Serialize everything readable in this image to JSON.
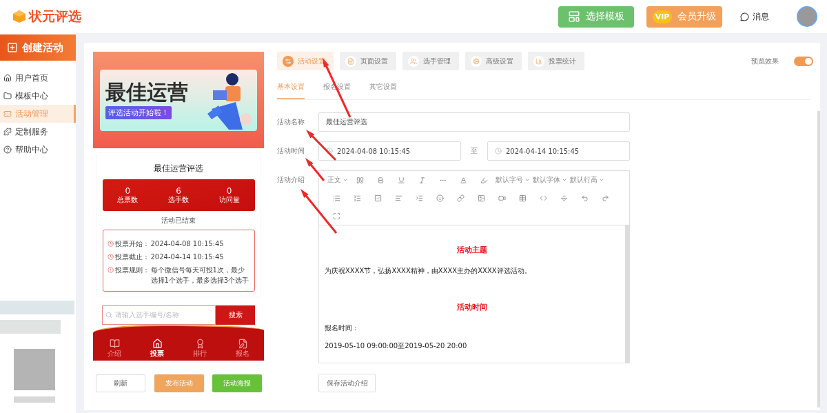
{
  "header": {
    "logo": "状元评选",
    "actions": [
      {
        "label": "选择模板",
        "kind": "template"
      },
      {
        "label": "会员升级",
        "kind": "vip",
        "badge": "VIP"
      }
    ],
    "messages": "消息"
  },
  "sidebar": {
    "create": "创建活动",
    "items": [
      {
        "label": "用户首页",
        "selected": false
      },
      {
        "label": "模板中心",
        "selected": false
      },
      {
        "label": "活动管理",
        "selected": true
      },
      {
        "label": "定制服务",
        "selected": false
      },
      {
        "label": "帮助中心",
        "selected": false
      }
    ]
  },
  "preview": {
    "banner_title": "最佳运营",
    "banner_subtitle": "评选活动开始啦！",
    "activity_title": "最佳运营评选",
    "stats": [
      {
        "value": "0",
        "label": "总票数"
      },
      {
        "value": "6",
        "label": "选手数"
      },
      {
        "value": "0",
        "label": "访问量"
      }
    ],
    "status": "活动已结束",
    "info": [
      {
        "kind": "clock",
        "label": "投票开始：",
        "value": "2024-04-08 10:15:45"
      },
      {
        "kind": "clock",
        "label": "投票截止：",
        "value": "2024-04-14 10:15:45"
      },
      {
        "kind": "alert",
        "label": "投票规则：",
        "value": "每个微信号每天可投1次，最少选择1个选手，最多选择3个选手"
      }
    ],
    "search": {
      "placeholder": "请输入选手编号/名称",
      "button": "搜索"
    },
    "nav": [
      {
        "label": "介绍",
        "selected": false
      },
      {
        "label": "投票",
        "selected": true
      },
      {
        "label": "排行",
        "selected": false
      },
      {
        "label": "报名",
        "selected": false
      }
    ],
    "buttons": [
      {
        "label": "刷新",
        "kind": "plain"
      },
      {
        "label": "发布活动",
        "kind": "orange"
      },
      {
        "label": "活动海报",
        "kind": "green"
      }
    ]
  },
  "tabs": [
    {
      "label": "活动设置",
      "selected": true
    },
    {
      "label": "页面设置",
      "selected": false
    },
    {
      "label": "选手管理",
      "selected": false
    },
    {
      "label": "高级设置",
      "selected": false
    },
    {
      "label": "投票统计",
      "selected": false
    }
  ],
  "preview_toggle": {
    "label": "预览效果",
    "on": true
  },
  "subtabs": [
    {
      "label": "基本设置",
      "selected": true
    },
    {
      "label": "报名设置",
      "selected": false
    },
    {
      "label": "其它设置",
      "selected": false
    }
  ],
  "form": {
    "name_label": "活动名称",
    "name_value": "最佳运营评选",
    "time_label": "活动时间",
    "start": "2024-04-08 10:15:45",
    "to": "至",
    "end": "2024-04-14 10:15:45",
    "intro_label": "活动介绍"
  },
  "editor": {
    "dropdowns": [
      "正文",
      "默认字号",
      "默认字体",
      "默认行高"
    ],
    "content": [
      {
        "kind": "heading",
        "text": "活动主题"
      },
      {
        "kind": "paragraph",
        "text": "为庆祝XXXX节，弘扬XXXX精神，由XXXX主办的XXXX评选活动。"
      },
      {
        "kind": "heading",
        "text": "活动时间"
      },
      {
        "kind": "paragraph",
        "text": "报名时间："
      },
      {
        "kind": "paragraph",
        "text": "2019-05-10 09:00:00至2019-05-20 20:00"
      }
    ]
  },
  "save_button": "保存活动介绍"
}
